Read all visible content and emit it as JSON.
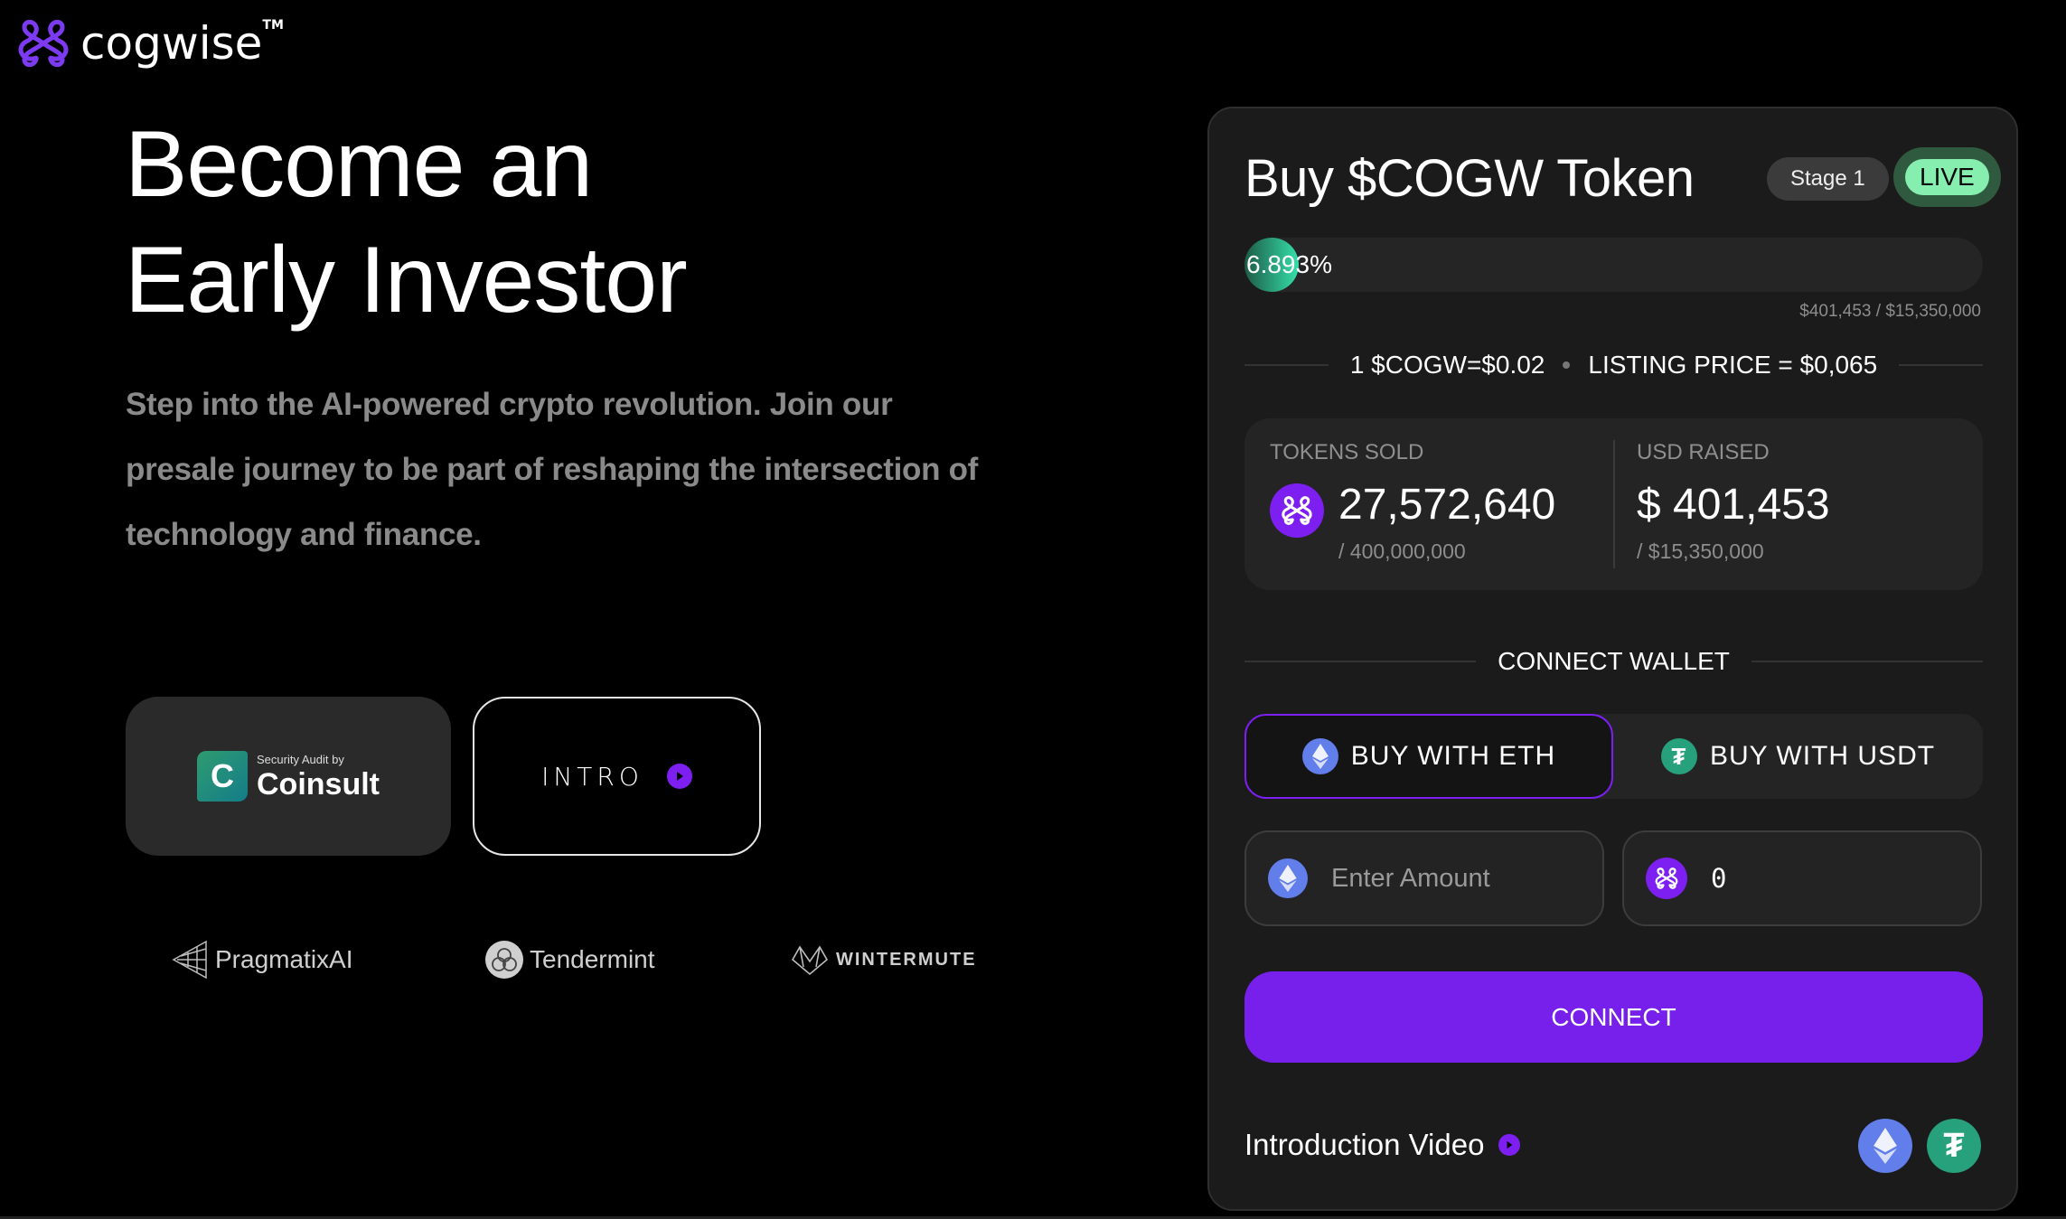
{
  "brand": {
    "name": "cogwise",
    "trademark": "TM",
    "accent_color": "#7c1ff0"
  },
  "hero": {
    "title_line1": "Become an",
    "title_line2": "Early Investor",
    "description": "Step into the AI-powered crypto revolution. Join our presale journey to be part of reshaping the intersection of technology and finance.",
    "audit_badge": {
      "caption": "Security Audit by",
      "name": "Coinsult",
      "icon": "coinsult-logo-icon"
    },
    "intro_button": {
      "label": "INTRO",
      "icon": "play-icon"
    }
  },
  "partners": [
    {
      "name": "PragmatixAI",
      "icon": "pragmatixai-logo-icon"
    },
    {
      "name": "Tendermint",
      "icon": "tendermint-logo-icon"
    },
    {
      "name": "WINTERMUTE",
      "icon": "wintermute-logo-icon"
    }
  ],
  "panel": {
    "title": "Buy $COGW Token",
    "stage_label": "Stage 1",
    "live_label": "LIVE",
    "progress": {
      "percent": 6.893,
      "label": "6.893%",
      "raised_text": "$401,453 / $15,350,000"
    },
    "price": {
      "current": "1 $COGW=$0.02",
      "listing": "LISTING PRICE = $0,065"
    },
    "stats": {
      "tokens_sold": {
        "label": "TOKENS SOLD",
        "value": "27,572,640",
        "total": "/ 400,000,000"
      },
      "usd_raised": {
        "label": "USD RAISED",
        "value": "$ 401,453",
        "total": "/ $15,350,000"
      }
    },
    "connect_wallet_label": "CONNECT WALLET",
    "tabs": [
      {
        "label": "BUY WITH ETH",
        "icon": "ethereum-icon",
        "active": true
      },
      {
        "label": "BUY WITH USDT",
        "icon": "tether-icon",
        "active": false
      }
    ],
    "amount_input": {
      "placeholder": "Enter Amount",
      "value": ""
    },
    "receive_input": {
      "value": "0"
    },
    "connect_button": "CONNECT",
    "intro_video_label": "Introduction Video",
    "footer_coins": [
      "ethereum-icon",
      "tether-icon"
    ],
    "colors": {
      "live": "#86eeae",
      "progress": "#35e0a8",
      "connect": "#7720ec"
    }
  }
}
